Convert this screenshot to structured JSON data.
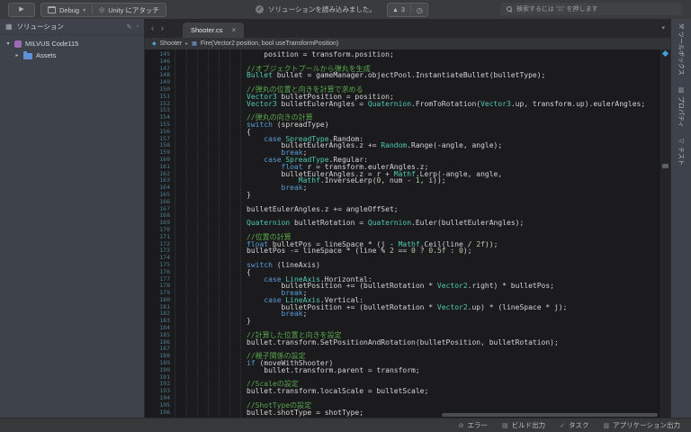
{
  "colors": {
    "accent_blue": "#3fa3e0",
    "keyword": "#569cd6",
    "type": "#4ec9b0",
    "comment": "#57a64a",
    "number": "#b5cea8",
    "code_text": "#d4d4d4",
    "line_number": "#4c7d8d",
    "sidebar_bg": "#3e424a",
    "editor_bg": "#1b1b1e",
    "toolbar_bg": "#3a3b3d"
  },
  "toolbar": {
    "play_glyph": "▶",
    "config_label": "Debug",
    "attach_label": "Unity にアタッチ",
    "status_message": "ソリューションを読み込みました。",
    "check_glyph": "✓",
    "warning_glyph": "▲",
    "warning_count": "3",
    "history_glyph": "◷",
    "search_placeholder": "検索するには '⌘' を押します"
  },
  "sidebar": {
    "title": "ソリューション",
    "header_icon": "▦",
    "tool_icons": [
      "✎",
      "▫"
    ],
    "tree": [
      {
        "label": "MILVUS Code115",
        "expander": "▾",
        "icon": "solution",
        "indent": 0
      },
      {
        "label": "Assets",
        "expander": "▸",
        "icon": "folder",
        "indent": 1
      }
    ]
  },
  "right_panel": {
    "items": [
      {
        "icon": "toolbox",
        "label": "ツールボックス"
      },
      {
        "icon": "properties",
        "label": "プロパティ"
      },
      {
        "icon": "tests",
        "label": "テスト"
      }
    ]
  },
  "editor": {
    "nav_back": "‹",
    "nav_forward": "›",
    "tab": {
      "label": "Shooter.cs",
      "close_glyph": "×"
    },
    "tab_overflow_glyph": "▾",
    "breadcrumb": {
      "class_name": "Shooter",
      "separator": "▸",
      "member": "Fire(Vector2 position, bool useTransformPosition)"
    },
    "lines": [
      {
        "n": 145,
        "s": [
          [
            "p",
            "    position = transform.position;"
          ]
        ]
      },
      {
        "n": 146,
        "s": []
      },
      {
        "n": 147,
        "s": [
          [
            "c",
            "//オブジェクトプールから弾丸を生成"
          ]
        ]
      },
      {
        "n": 148,
        "s": [
          [
            "t",
            "Bullet"
          ],
          [
            "p",
            " bullet = gameManager.objectPool.InstantiateBullet(bulletType);"
          ]
        ]
      },
      {
        "n": 149,
        "s": []
      },
      {
        "n": 150,
        "s": [
          [
            "c",
            "//弾丸の位置と向きを計算で求める"
          ]
        ]
      },
      {
        "n": 151,
        "s": [
          [
            "t",
            "Vector3"
          ],
          [
            "p",
            " bulletPosition = position;"
          ]
        ]
      },
      {
        "n": 152,
        "s": [
          [
            "t",
            "Vector3"
          ],
          [
            "p",
            " bulletEulerAngles = "
          ],
          [
            "t",
            "Quaternion"
          ],
          [
            "p",
            ".FromToRotation("
          ],
          [
            "t",
            "Vector3"
          ],
          [
            "p",
            ".up, transform.up).eulerAngles;"
          ]
        ]
      },
      {
        "n": 153,
        "s": []
      },
      {
        "n": 154,
        "s": [
          [
            "c",
            "//弾丸の向きの計算"
          ]
        ]
      },
      {
        "n": 155,
        "s": [
          [
            "k",
            "switch"
          ],
          [
            "p",
            " (spreadType)"
          ]
        ]
      },
      {
        "n": 156,
        "s": [
          [
            "p",
            "{"
          ]
        ]
      },
      {
        "n": 157,
        "s": [
          [
            "p",
            "    "
          ],
          [
            "k",
            "case"
          ],
          [
            "p",
            " "
          ],
          [
            "t",
            "SpreadType"
          ],
          [
            "p",
            ".Random:"
          ]
        ]
      },
      {
        "n": 158,
        "s": [
          [
            "p",
            "        bulletEulerAngles.z += "
          ],
          [
            "t",
            "Random"
          ],
          [
            "p",
            ".Range(-angle, angle);"
          ]
        ]
      },
      {
        "n": 159,
        "s": [
          [
            "p",
            "        "
          ],
          [
            "k",
            "break"
          ],
          [
            "p",
            ";"
          ]
        ]
      },
      {
        "n": 160,
        "s": [
          [
            "p",
            "    "
          ],
          [
            "k",
            "case"
          ],
          [
            "p",
            " "
          ],
          [
            "t",
            "SpreadType"
          ],
          [
            "p",
            ".Regular:"
          ]
        ]
      },
      {
        "n": 161,
        "s": [
          [
            "p",
            "        "
          ],
          [
            "k",
            "float"
          ],
          [
            "p",
            " r = transform.eulerAngles.z;"
          ]
        ]
      },
      {
        "n": 162,
        "s": [
          [
            "p",
            "        bulletEulerAngles.z = r + "
          ],
          [
            "t",
            "Mathf"
          ],
          [
            "p",
            ".Lerp(-angle, angle,"
          ]
        ]
      },
      {
        "n": 163,
        "s": [
          [
            "p",
            "            "
          ],
          [
            "t",
            "Mathf"
          ],
          [
            "p",
            ".InverseLerp("
          ],
          [
            "n",
            "0"
          ],
          [
            "p",
            ", num - "
          ],
          [
            "n",
            "1"
          ],
          [
            "p",
            ", i));"
          ]
        ]
      },
      {
        "n": 164,
        "s": [
          [
            "p",
            "        "
          ],
          [
            "k",
            "break"
          ],
          [
            "p",
            ";"
          ]
        ]
      },
      {
        "n": 165,
        "s": [
          [
            "p",
            "}"
          ]
        ]
      },
      {
        "n": 166,
        "s": []
      },
      {
        "n": 167,
        "s": [
          [
            "p",
            "bulletEulerAngles.z += angleOffSet;"
          ]
        ]
      },
      {
        "n": 168,
        "s": []
      },
      {
        "n": 169,
        "s": [
          [
            "t",
            "Quaternion"
          ],
          [
            "p",
            " bulletRotation = "
          ],
          [
            "t",
            "Quaternion"
          ],
          [
            "p",
            ".Euler(bulletEulerAngles);"
          ]
        ]
      },
      {
        "n": 170,
        "s": []
      },
      {
        "n": 171,
        "s": [
          [
            "c",
            "//位置の計算"
          ]
        ]
      },
      {
        "n": 172,
        "s": [
          [
            "k",
            "float"
          ],
          [
            "p",
            " bulletPos = lineSpace * (j - "
          ],
          [
            "t",
            "Mathf"
          ],
          [
            "p",
            ".Ceil(line / "
          ],
          [
            "n",
            "2f"
          ],
          [
            "p",
            "));"
          ]
        ]
      },
      {
        "n": 173,
        "s": [
          [
            "p",
            "bulletPos -= lineSpace * (line % "
          ],
          [
            "n",
            "2"
          ],
          [
            "p",
            " == "
          ],
          [
            "n",
            "0"
          ],
          [
            "p",
            " ? "
          ],
          [
            "n",
            "0.5f"
          ],
          [
            "p",
            " : "
          ],
          [
            "n",
            "0"
          ],
          [
            "p",
            ");"
          ]
        ]
      },
      {
        "n": 174,
        "s": []
      },
      {
        "n": 175,
        "s": [
          [
            "k",
            "switch"
          ],
          [
            "p",
            " (lineAxis)"
          ]
        ]
      },
      {
        "n": 176,
        "s": [
          [
            "p",
            "{"
          ]
        ]
      },
      {
        "n": 177,
        "s": [
          [
            "p",
            "    "
          ],
          [
            "k",
            "case"
          ],
          [
            "p",
            " "
          ],
          [
            "t",
            "LineAxis"
          ],
          [
            "p",
            ".Horizontal:"
          ]
        ]
      },
      {
        "n": 178,
        "s": [
          [
            "p",
            "        bulletPosition += (bulletRotation * "
          ],
          [
            "t",
            "Vector2"
          ],
          [
            "p",
            ".right) * bulletPos;"
          ]
        ]
      },
      {
        "n": 179,
        "s": [
          [
            "p",
            "        "
          ],
          [
            "k",
            "break"
          ],
          [
            "p",
            ";"
          ]
        ]
      },
      {
        "n": 180,
        "s": [
          [
            "p",
            "    "
          ],
          [
            "k",
            "case"
          ],
          [
            "p",
            " "
          ],
          [
            "t",
            "LineAxis"
          ],
          [
            "p",
            ".Vertical:"
          ]
        ]
      },
      {
        "n": 181,
        "s": [
          [
            "p",
            "        bulletPosition += (bulletRotation * "
          ],
          [
            "t",
            "Vector2"
          ],
          [
            "p",
            ".up) * (lineSpace * j);"
          ]
        ]
      },
      {
        "n": 182,
        "s": [
          [
            "p",
            "        "
          ],
          [
            "k",
            "break"
          ],
          [
            "p",
            ";"
          ]
        ]
      },
      {
        "n": 183,
        "s": [
          [
            "p",
            "}"
          ]
        ]
      },
      {
        "n": 184,
        "s": []
      },
      {
        "n": 185,
        "s": [
          [
            "c",
            "//計算した位置と向きを設定"
          ]
        ]
      },
      {
        "n": 186,
        "s": [
          [
            "p",
            "bullet.transform.SetPositionAndRotation(bulletPosition, bulletRotation);"
          ]
        ]
      },
      {
        "n": 187,
        "s": []
      },
      {
        "n": 188,
        "s": [
          [
            "c",
            "//親子関係の設定"
          ]
        ]
      },
      {
        "n": 189,
        "s": [
          [
            "k",
            "if"
          ],
          [
            "p",
            " (moveWithShooter)"
          ]
        ]
      },
      {
        "n": 190,
        "s": [
          [
            "p",
            "    bullet.transform.parent = transform;"
          ]
        ]
      },
      {
        "n": 191,
        "s": []
      },
      {
        "n": 192,
        "s": [
          [
            "c",
            "//Scaleの設定"
          ]
        ]
      },
      {
        "n": 193,
        "s": [
          [
            "p",
            "bullet.transform.localScale = bulletScale;"
          ]
        ]
      },
      {
        "n": 194,
        "s": []
      },
      {
        "n": 195,
        "s": [
          [
            "c",
            "//ShotTypeの設定"
          ]
        ]
      },
      {
        "n": 196,
        "s": [
          [
            "p",
            "bullet.shotType = shotType;"
          ]
        ]
      }
    ]
  },
  "status_bar": {
    "items": [
      {
        "icon": "error",
        "label": "エラー"
      },
      {
        "icon": "build-output",
        "label": "ビルド出力"
      },
      {
        "icon": "tasks",
        "label": "タスク"
      },
      {
        "icon": "app-output",
        "label": "アプリケーション出力"
      }
    ]
  }
}
